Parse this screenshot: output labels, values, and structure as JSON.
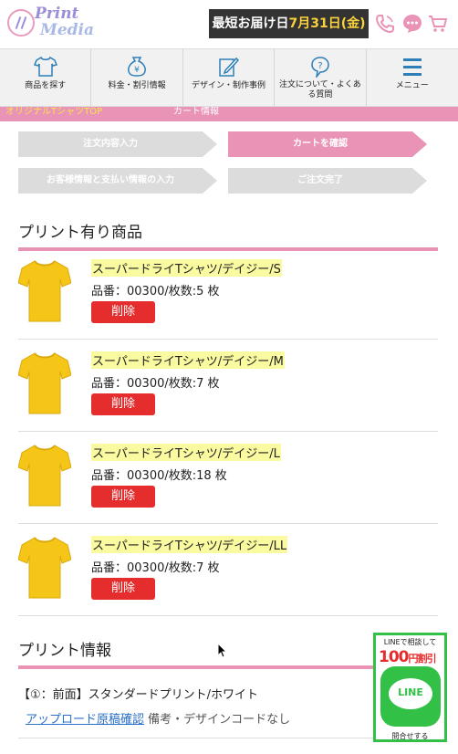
{
  "header": {
    "logo_line1": "Print",
    "logo_line2": "Media",
    "delivery_prefix": "最短お届け日",
    "delivery_date": "7月31日(金)"
  },
  "nav": [
    {
      "label": "商品を探す",
      "icon": "tshirt-icon"
    },
    {
      "label": "料金・割引情報",
      "icon": "money-bag-icon"
    },
    {
      "label": "デザイン・制作事例",
      "icon": "design-edit-icon"
    },
    {
      "label": "注文について・よくある質問",
      "icon": "question-icon"
    },
    {
      "label": "メニュー",
      "icon": "hamburger-menu-icon"
    }
  ],
  "breadcrumb": {
    "first": "オリジナルTシャツTOP",
    "current": "カート情報"
  },
  "steps": [
    {
      "label": "注文内容入力",
      "active": false
    },
    {
      "label": "カートを確認",
      "active": true
    },
    {
      "label": "お客様情報と支払い情報の入力",
      "active": false
    },
    {
      "label": "ご注文完了",
      "active": false
    }
  ],
  "products_title": "プリント有り商品",
  "items": [
    {
      "name": "スーパードライTシャツ/デイジー/S",
      "meta": "品番：00300/枚数:5 枚",
      "delete": "削除"
    },
    {
      "name": "スーパードライTシャツ/デイジー/M",
      "meta": "品番：00300/枚数:7 枚",
      "delete": "削除"
    },
    {
      "name": "スーパードライTシャツ/デイジー/L",
      "meta": "品番：00300/枚数:18 枚",
      "delete": "削除"
    },
    {
      "name": "スーパードライTシャツ/デイジー/LL",
      "meta": "品番：00300/枚数:7 枚",
      "delete": "削除"
    }
  ],
  "print_section_title": "プリント情報",
  "print_info": "【①：前面】スタンダードプリント/ホワイト",
  "upload_link": "アップロード原稿確認",
  "remarks": "備考・デザインコードなし",
  "line_banner": {
    "top": "LINEで相談して",
    "discount": "100",
    "discount_unit": "円割引",
    "logo": "LINE",
    "bottom": "問合せする"
  },
  "colors": {
    "accent_pink": "#e993b6",
    "delete_red": "#e52d2d",
    "line_green": "#32c146",
    "shirt_yellow": "#f5c518"
  }
}
